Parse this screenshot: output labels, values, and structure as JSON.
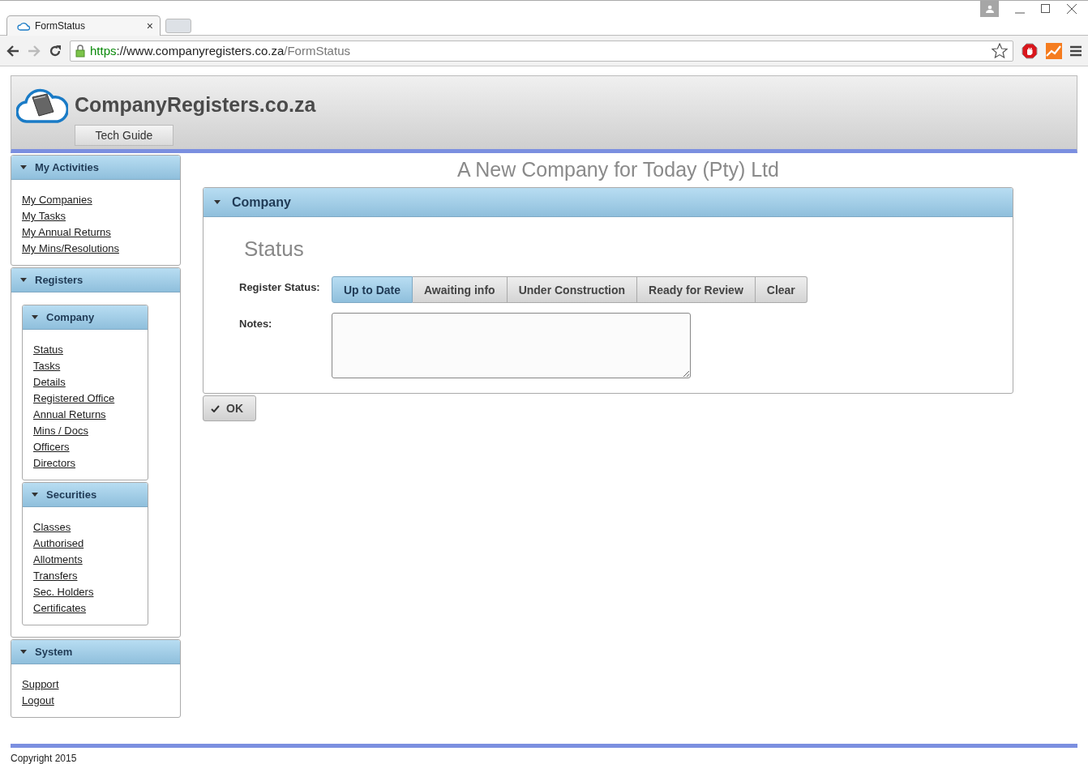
{
  "browser": {
    "tab_title": "FormStatus",
    "tab_close": "×",
    "url": {
      "scheme": "https",
      "host": "://www.companyregisters.co.za",
      "path": "/FormStatus"
    }
  },
  "header": {
    "site_name": "CompanyRegisters.co.za",
    "button": "Tech Guide"
  },
  "sidebar": [
    {
      "title": "My Activities",
      "expanded": true,
      "links": [
        "My Companies",
        "My Tasks",
        "My Annual Returns",
        "My Mins/Resolutions"
      ]
    },
    {
      "title": "Registers",
      "expanded": true,
      "panels": [
        {
          "title": "Company",
          "expanded": true,
          "links": [
            "Status",
            "Tasks",
            "Details",
            "Registered Office",
            "Annual Returns",
            "Mins / Docs",
            "Officers",
            "Directors"
          ]
        },
        {
          "title": "Securities",
          "expanded": true,
          "links": [
            "Classes",
            "Authorised",
            "Allotments",
            "Transfers",
            "Sec. Holders",
            "Certificates"
          ]
        }
      ]
    },
    {
      "title": "System",
      "expanded": true,
      "links": [
        "Support",
        "Logout"
      ]
    }
  ],
  "main": {
    "company_name": "A New Company for Today (Pty) Ltd",
    "panel_title": "Company",
    "panel_expanded": true,
    "heading": "Status",
    "register_status_label": "Register Status:",
    "status_options": [
      {
        "label": "Up to Date",
        "selected": true
      },
      {
        "label": "Awaiting info",
        "selected": false
      },
      {
        "label": "Under Construction",
        "selected": false
      },
      {
        "label": "Ready for Review",
        "selected": false
      },
      {
        "label": "Clear",
        "selected": false
      }
    ],
    "notes_label": "Notes:",
    "ok_button": "OK"
  },
  "footer": {
    "copyright": "Copyright 2015"
  }
}
